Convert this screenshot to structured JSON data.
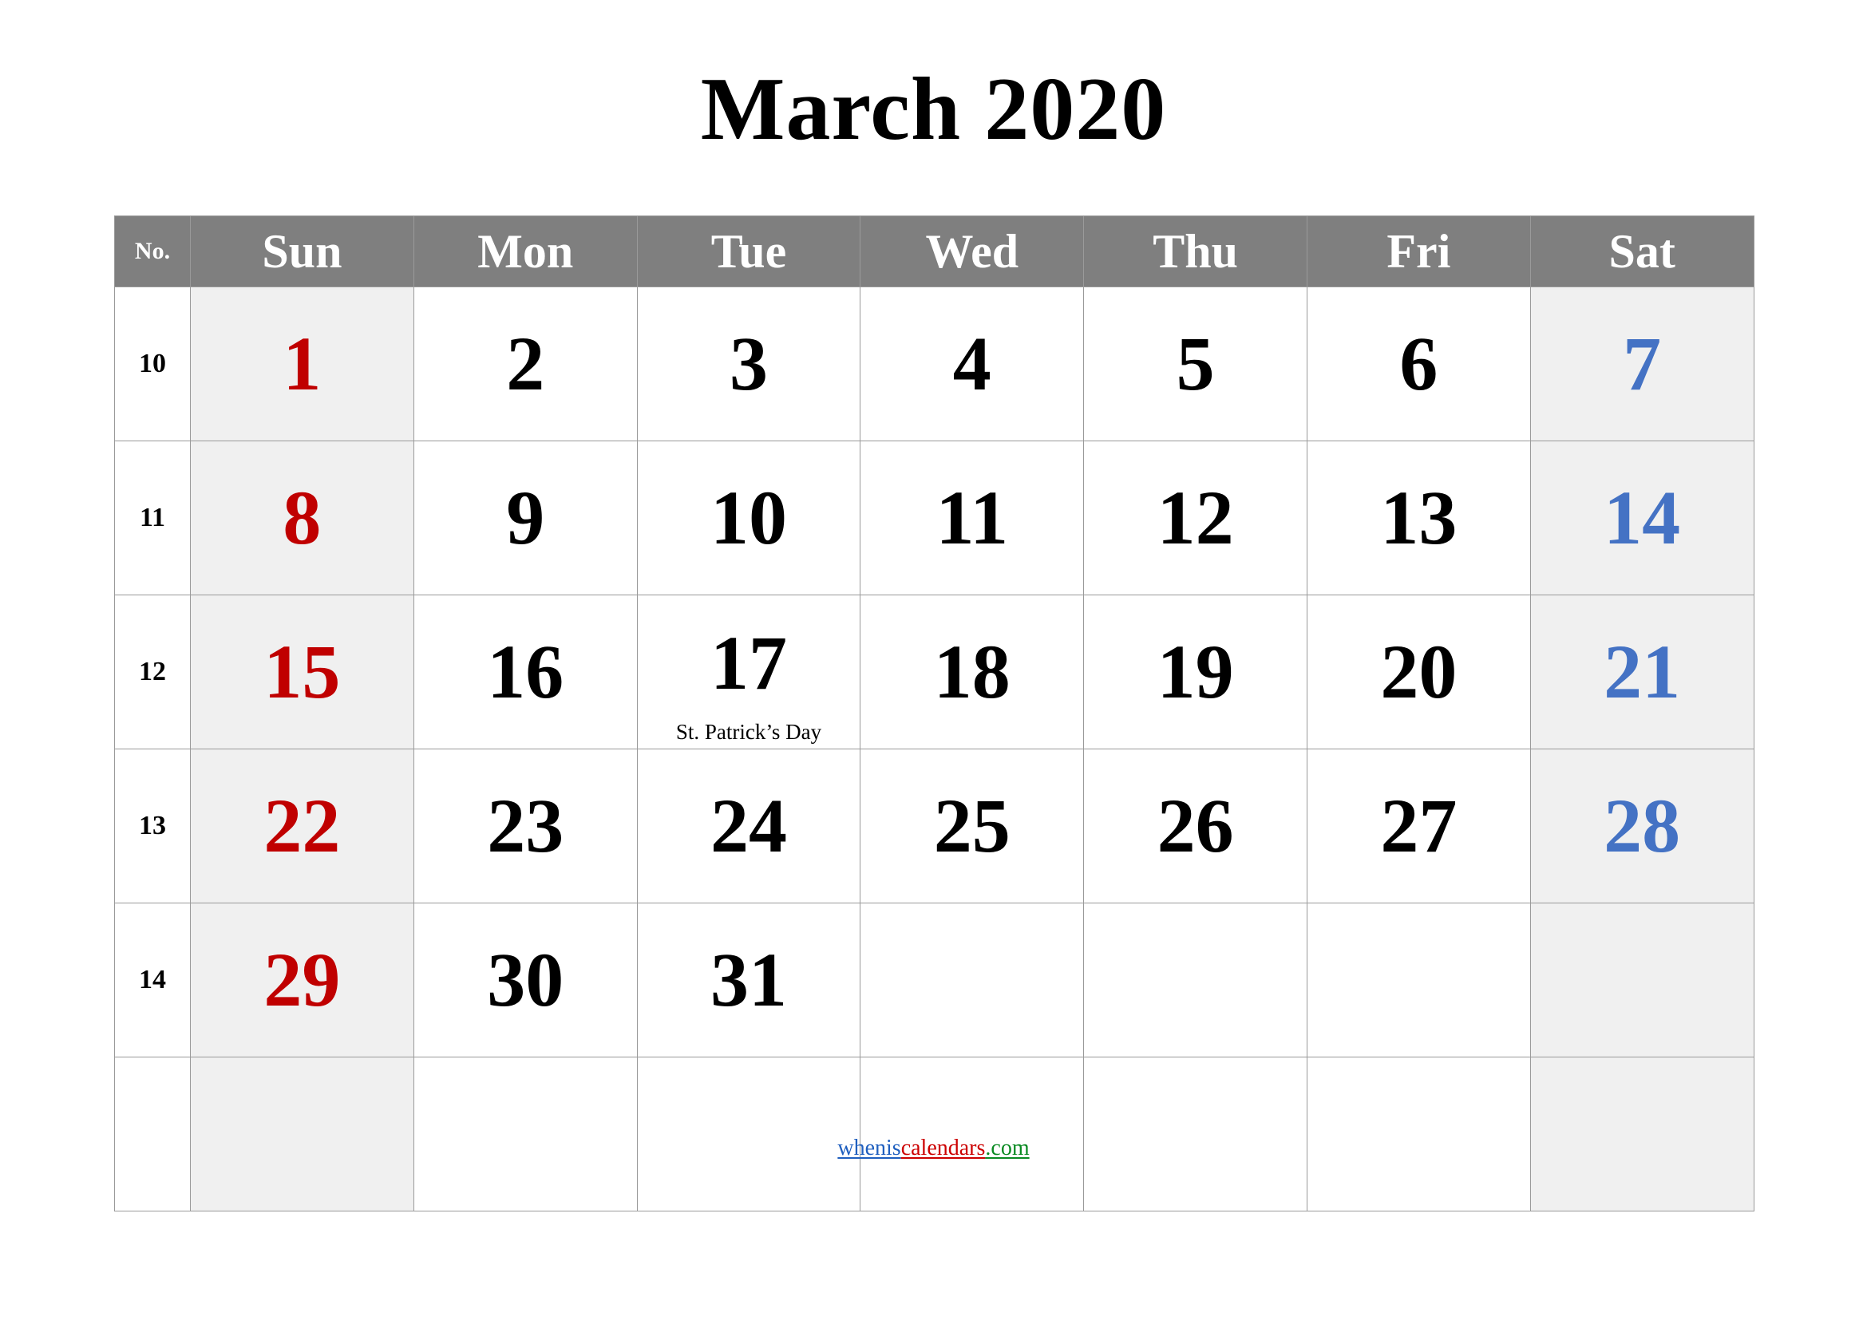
{
  "title": "March 2020",
  "header": {
    "week_no_label": "No.",
    "days": [
      "Sun",
      "Mon",
      "Tue",
      "Wed",
      "Thu",
      "Fri",
      "Sat"
    ]
  },
  "colors": {
    "header_bg": "#7f7f7f",
    "header_text": "#ffffff",
    "weekend_cell_bg": "#f0f0f0",
    "sunday_text": "#c00000",
    "saturday_text": "#4472c4",
    "weekday_text": "#000000",
    "grid_line": "#9a9a9a",
    "link_blue": "#1f5fbf",
    "link_red": "#cc0000",
    "link_green": "#0a8a22"
  },
  "weeks": [
    {
      "week_no": "10",
      "days": [
        {
          "num": "1",
          "note": ""
        },
        {
          "num": "2",
          "note": ""
        },
        {
          "num": "3",
          "note": ""
        },
        {
          "num": "4",
          "note": ""
        },
        {
          "num": "5",
          "note": ""
        },
        {
          "num": "6",
          "note": ""
        },
        {
          "num": "7",
          "note": ""
        }
      ]
    },
    {
      "week_no": "11",
      "days": [
        {
          "num": "8",
          "note": ""
        },
        {
          "num": "9",
          "note": ""
        },
        {
          "num": "10",
          "note": ""
        },
        {
          "num": "11",
          "note": ""
        },
        {
          "num": "12",
          "note": ""
        },
        {
          "num": "13",
          "note": ""
        },
        {
          "num": "14",
          "note": ""
        }
      ]
    },
    {
      "week_no": "12",
      "days": [
        {
          "num": "15",
          "note": ""
        },
        {
          "num": "16",
          "note": ""
        },
        {
          "num": "17",
          "note": "St. Patrick’s Day"
        },
        {
          "num": "18",
          "note": ""
        },
        {
          "num": "19",
          "note": ""
        },
        {
          "num": "20",
          "note": ""
        },
        {
          "num": "21",
          "note": ""
        }
      ]
    },
    {
      "week_no": "13",
      "days": [
        {
          "num": "22",
          "note": ""
        },
        {
          "num": "23",
          "note": ""
        },
        {
          "num": "24",
          "note": ""
        },
        {
          "num": "25",
          "note": ""
        },
        {
          "num": "26",
          "note": ""
        },
        {
          "num": "27",
          "note": ""
        },
        {
          "num": "28",
          "note": ""
        }
      ]
    },
    {
      "week_no": "14",
      "days": [
        {
          "num": "29",
          "note": ""
        },
        {
          "num": "30",
          "note": ""
        },
        {
          "num": "31",
          "note": ""
        },
        {
          "num": "",
          "note": ""
        },
        {
          "num": "",
          "note": ""
        },
        {
          "num": "",
          "note": ""
        },
        {
          "num": "",
          "note": ""
        }
      ]
    },
    {
      "week_no": "",
      "days": [
        {
          "num": "",
          "note": ""
        },
        {
          "num": "",
          "note": ""
        },
        {
          "num": "",
          "note": ""
        },
        {
          "num": "",
          "note": ""
        },
        {
          "num": "",
          "note": ""
        },
        {
          "num": "",
          "note": ""
        },
        {
          "num": "",
          "note": ""
        }
      ]
    }
  ],
  "footer": {
    "link_part_1": "whenis",
    "link_part_2": "calendars",
    "link_part_3": ".com"
  }
}
